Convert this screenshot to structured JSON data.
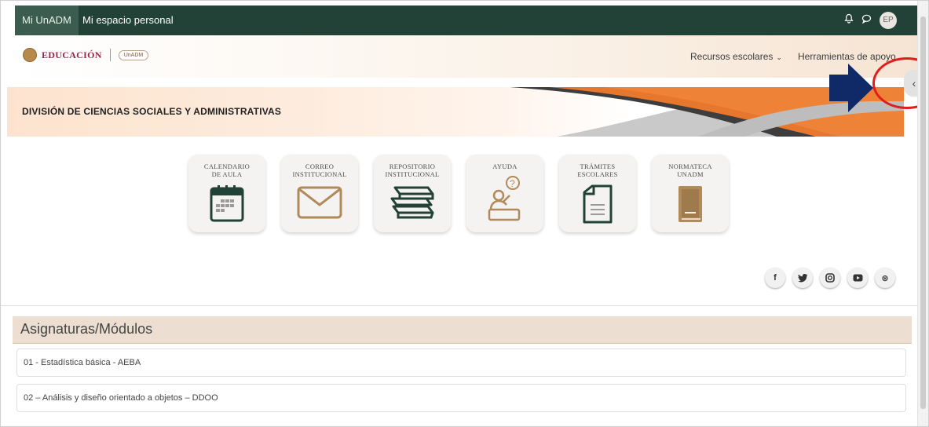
{
  "topbar": {
    "active_tab": "Mi UnADM",
    "personal_tab": "Mi espacio personal",
    "avatar_initials": "EP"
  },
  "header": {
    "brand": "EDUCACIÓN",
    "unadm_logo_text": "UnADM",
    "menu": [
      {
        "label": "Recursos escolares"
      },
      {
        "label": "Herramientas de apoyo"
      }
    ]
  },
  "banner": {
    "title": "DIVISIÓN DE CIENCIAS SOCIALES Y ADMINISTRATIVAS"
  },
  "tiles": [
    {
      "label": "CALENDARIO\nDE AULA",
      "icon": "calendar-icon"
    },
    {
      "label": "CORREO\nINSTITUCIONAL",
      "icon": "envelope-icon"
    },
    {
      "label": "REPOSITORIO\nINSTITUCIONAL",
      "icon": "books-icon"
    },
    {
      "label": "AYUDA",
      "icon": "help-desk-icon"
    },
    {
      "label": "TRÁMITES\nESCOLARES",
      "icon": "document-icon"
    },
    {
      "label": "NORMATECA\nUNADM",
      "icon": "book-icon"
    }
  ],
  "social": [
    {
      "name": "facebook",
      "glyph": "f"
    },
    {
      "name": "twitter",
      "glyph": "t"
    },
    {
      "name": "instagram",
      "glyph": "◎"
    },
    {
      "name": "youtube",
      "glyph": "▶"
    },
    {
      "name": "dribbble",
      "glyph": "⊛"
    }
  ],
  "modules": {
    "title": "Asignaturas/Módulos",
    "items": [
      {
        "label": "01 - Estadística básica - AEBA"
      },
      {
        "label": "02 – Análisis y diseño orientado a objetos – DDOO"
      }
    ]
  },
  "drawer_toggle_glyph": "‹",
  "colors": {
    "navbar": "#234237",
    "accent_orange": "#e8772e",
    "modules_header": "#ecdfd1",
    "annotation_red": "#e31c1c",
    "annotation_arrow": "#0f2a66"
  }
}
